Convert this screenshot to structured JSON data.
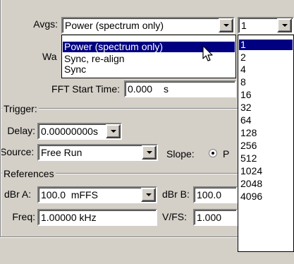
{
  "avgs": {
    "label": "Avgs:",
    "mode_value": "Power (spectrum only)",
    "count_value": "1",
    "mode_options": [
      "Power (spectrum only)",
      "Sync, re-align",
      "Sync"
    ],
    "count_options": [
      "1",
      "2",
      "4",
      "8",
      "16",
      "32",
      "64",
      "128",
      "256",
      "512",
      "1024",
      "2048",
      "4096"
    ]
  },
  "window_label_partial": "Wa",
  "fft": {
    "label": "FFT Start Time:",
    "value_partial": "0.000",
    "unit": "s"
  },
  "trigger": {
    "title": "Trigger:",
    "delay_label": "Delay:",
    "delay_value": "0.00000000s",
    "source_label": "Source:",
    "source_value": "Free Run",
    "slope_label": "Slope:",
    "slope_partial": "P"
  },
  "references": {
    "title": "References",
    "dbra_label": "dBr A:",
    "dbra_value": "100.0  mFFS",
    "dbrb_label": "dBr B:",
    "dbrb_value": "100.0",
    "freq_label": "Freq:",
    "freq_value": "1.00000 kHz",
    "vfs_label": "V/FS:",
    "vfs_value": "1.000"
  }
}
